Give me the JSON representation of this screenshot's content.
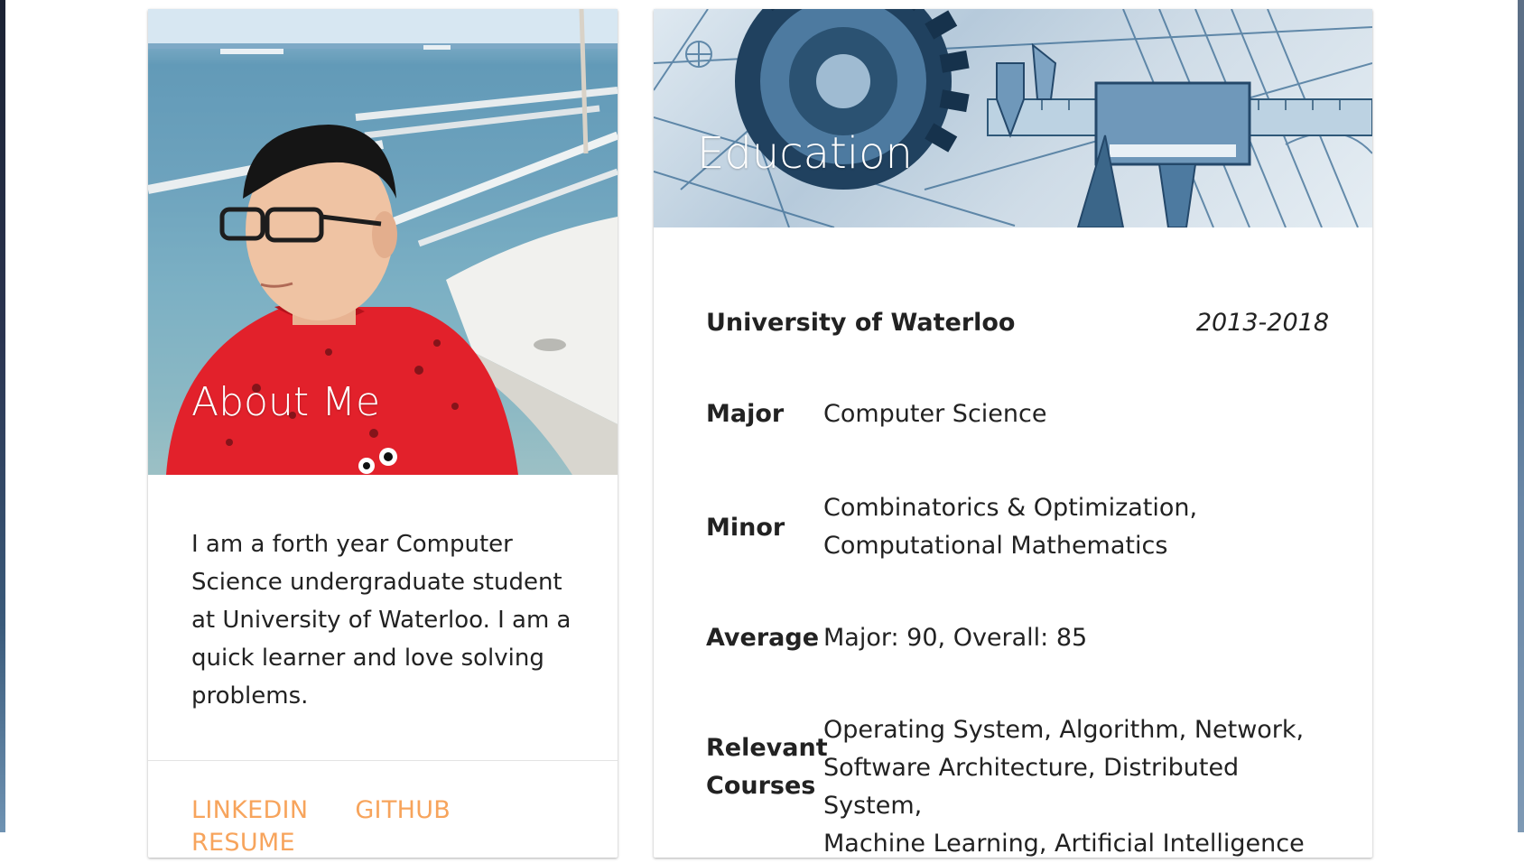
{
  "about": {
    "title": "About Me",
    "text": "I am a forth year Computer Science undergraduate student at University of Waterloo. I am a quick learner and love solving problems.",
    "links": {
      "linkedin": "LINKEDIN",
      "github": "GITHUB",
      "resume": "RESUME"
    },
    "link_color": "#f7a45c"
  },
  "education": {
    "title": "Education",
    "school": "University of Waterloo",
    "years": "2013-2018",
    "rows": {
      "major": {
        "label": "Major",
        "value": "Computer Science"
      },
      "minor": {
        "label": "Minor",
        "value_line1": "Combinatorics & Optimization,",
        "value_line2": "Computational Mathematics"
      },
      "average": {
        "label": "Average",
        "value": "Major: 90, Overall: 85"
      },
      "courses": {
        "label_line1": "Relevant",
        "label_line2": "Courses",
        "value_line1": "Operating System, Algorithm, Network,",
        "value_line2": "Software Architecture, Distributed System,",
        "value_line3": "Machine Learning, Artificial Intelligence"
      }
    }
  }
}
